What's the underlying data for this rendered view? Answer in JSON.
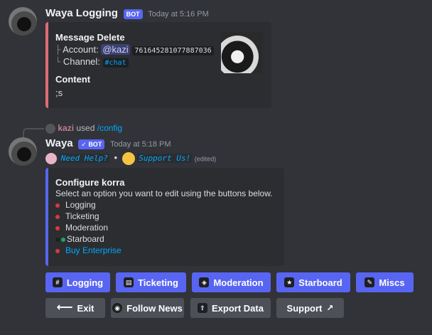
{
  "message1": {
    "username": "Waya Logging",
    "badge": "BOT",
    "timestamp": "Today at 5:16 PM",
    "embed": {
      "accent": "#e06c75",
      "title": "Message Delete",
      "account_label": "Account:",
      "account_mention": "@kazi",
      "account_id": "761645281077887036",
      "channel_label": "Channel:",
      "channel_value": "#chat",
      "content_title": "Content",
      "content_value": ";s"
    }
  },
  "reply_header": {
    "user": "kazi",
    "used": "used",
    "command": "/config"
  },
  "message2": {
    "username": "Waya",
    "badge": "BOT",
    "timestamp": "Today at 5:18 PM",
    "need_help": "Need Help?",
    "separator": "•",
    "support_us": "Support Us!",
    "edited": "(edited)",
    "embed": {
      "accent": "#5865f2",
      "title": "Configure korra",
      "description": "Select an option you want to edit using the buttons below.",
      "options": [
        {
          "label": "Logging",
          "status_color": "#da373c"
        },
        {
          "label": "Ticketing",
          "status_color": "#da373c"
        },
        {
          "label": "Moderation",
          "status_color": "#da373c"
        },
        {
          "label": "Starboard",
          "status_color": "#23a55a"
        },
        {
          "label": "Buy Enterprise",
          "status_color": "#da373c"
        }
      ]
    }
  },
  "buttons_row1": [
    {
      "label": "Logging",
      "icon": "hash-icon"
    },
    {
      "label": "Ticketing",
      "icon": "ticket-icon"
    },
    {
      "label": "Moderation",
      "icon": "shield-icon"
    },
    {
      "label": "Starboard",
      "icon": "star-icon"
    },
    {
      "label": "Miscs",
      "icon": "wrench-icon"
    }
  ],
  "buttons_row2": [
    {
      "label": "Exit",
      "icon": "arrow-left-icon"
    },
    {
      "label": "Follow News",
      "icon": "github-icon"
    },
    {
      "label": "Export Data",
      "icon": "export-icon"
    },
    {
      "label": "Support",
      "icon": "external-link-icon"
    }
  ]
}
